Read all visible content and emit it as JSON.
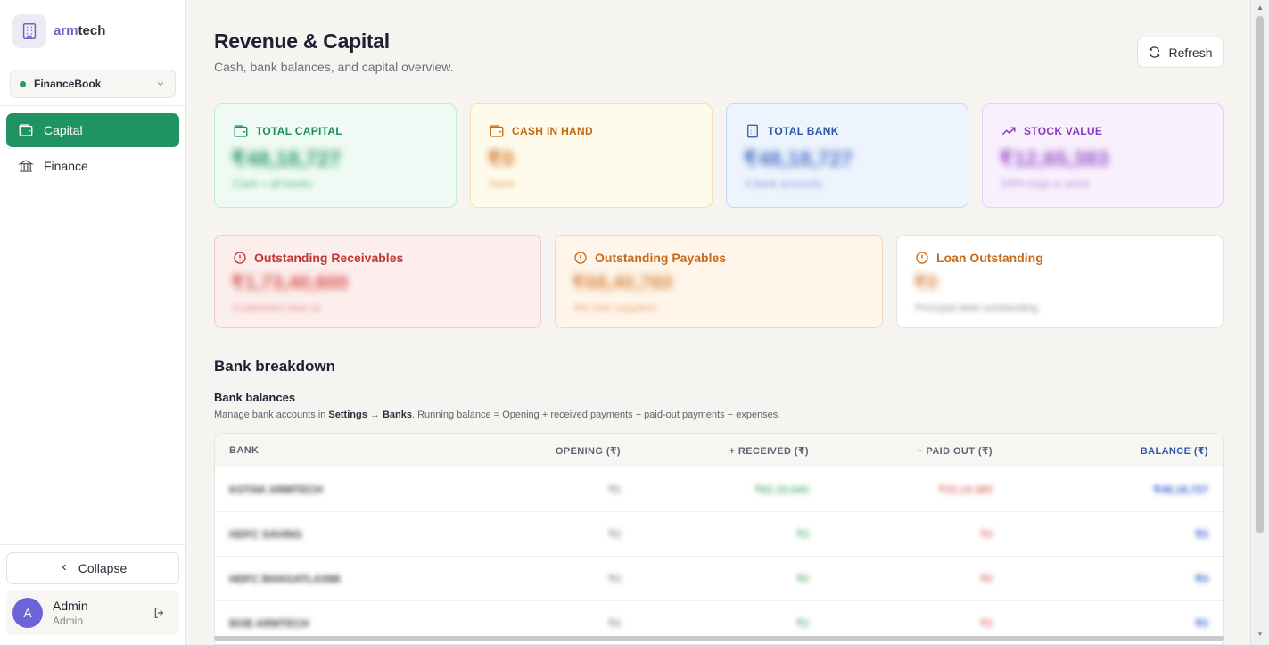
{
  "brand": {
    "prefix": "arm",
    "suffix": "tech"
  },
  "workspace": {
    "name": "FinanceBook",
    "status_color": "#1f9d6b"
  },
  "nav": [
    {
      "label": "Capital",
      "icon": "wallet-icon",
      "active": true
    },
    {
      "label": "Finance",
      "icon": "bank-icon",
      "active": false
    }
  ],
  "sidebar_footer": {
    "collapse_label": "Collapse",
    "user_initial": "A",
    "user_name": "Admin",
    "user_role": "Admin"
  },
  "header": {
    "title": "Revenue & Capital",
    "subtitle": "Cash, bank balances, and capital overview.",
    "refresh_label": "Refresh"
  },
  "stats": [
    {
      "label": "TOTAL CAPITAL",
      "value": "₹48,18,727",
      "foot": "Cash + all banks",
      "icon": "wallet-icon",
      "color": "#1f8a5e"
    },
    {
      "label": "CASH IN HAND",
      "value": "₹0",
      "foot": "Hand",
      "icon": "wallet-icon",
      "color": "#c26a12"
    },
    {
      "label": "TOTAL BANK",
      "value": "₹48,18,727",
      "foot": "4 bank accounts",
      "icon": "building-icon",
      "color": "#2f57a8"
    },
    {
      "label": "STOCK VALUE",
      "value": "₹12,65,383",
      "foot": "GRN bags in stock",
      "icon": "trending-up-icon",
      "color": "#8a3bbf"
    }
  ],
  "outstanding": [
    {
      "label": "Outstanding Receivables",
      "value": "₹1,73,40,600",
      "foot": "Customers owe us",
      "color": "#c0352f"
    },
    {
      "label": "Outstanding Payables",
      "value": "₹68,40,760",
      "foot": "We owe suppliers",
      "color": "#c96a1a"
    },
    {
      "label": "Loan Outstanding",
      "value": "₹0",
      "foot": "Principal debt outstanding",
      "color": "#c96a1a"
    }
  ],
  "bank_section": {
    "title": "Bank breakdown",
    "subtitle": "Bank balances",
    "desc_prefix": "Manage bank accounts in ",
    "desc_settings": "Settings",
    "desc_arrow": " → ",
    "desc_banks": "Banks",
    "desc_suffix": ". Running balance = Opening + received payments − paid-out payments − expenses."
  },
  "bank_table": {
    "columns": [
      "BANK",
      "OPENING (₹)",
      "+ RECEIVED (₹)",
      "− PAID OUT (₹)",
      "BALANCE (₹)"
    ],
    "rows": [
      {
        "bank": "KOTAK ARMTECH",
        "opening": "₹0",
        "received": "₹82,33,640",
        "paid": "₹33,19,380",
        "balance": "₹48,18,727"
      },
      {
        "bank": "HDFC SAVING",
        "opening": "₹0",
        "received": "₹0",
        "paid": "₹0",
        "balance": "₹0"
      },
      {
        "bank": "HDFC BHAGATLAXMI",
        "opening": "₹0",
        "received": "₹0",
        "paid": "₹0",
        "balance": "₹0"
      },
      {
        "bank": "BOB ARMTECH",
        "opening": "₹0",
        "received": "₹0",
        "paid": "₹0",
        "balance": "₹0"
      }
    ]
  }
}
